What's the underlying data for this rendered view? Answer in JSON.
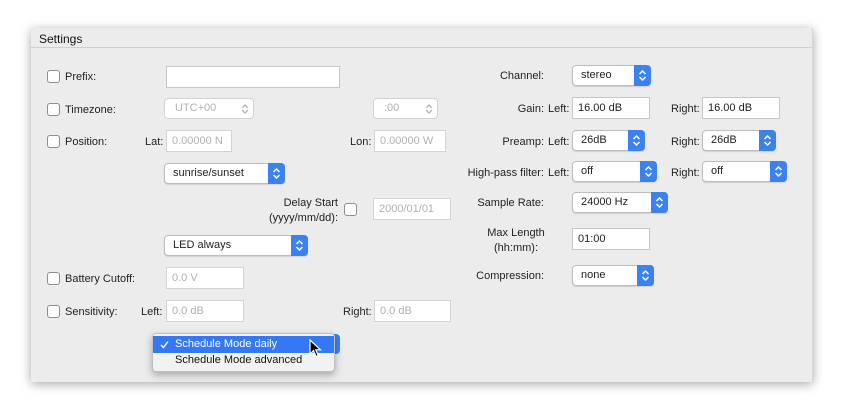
{
  "section_title": "Settings",
  "left": {
    "prefix": {
      "label": "Prefix:",
      "value": ""
    },
    "timezone": {
      "label": "Timezone:",
      "value": "UTC+00",
      "minutes": ":00"
    },
    "position": {
      "label": "Position:",
      "lat_label": "Lat:",
      "lat_value": "0.00000 N",
      "lon_label": "Lon:",
      "lon_value": "0.00000 W"
    },
    "schedule_type": "sunrise/sunset",
    "delay_start": {
      "label_line1": "Delay Start",
      "label_line2": "(yyyy/mm/dd):",
      "value": "2000/01/01"
    },
    "led": "LED always",
    "battery_cutoff": {
      "label": "Battery Cutoff:",
      "value": "0.0 V"
    },
    "sensitivity": {
      "label": "Sensitivity:",
      "left_label": "Left:",
      "left_value": "0.0 dB",
      "right_label": "Right:",
      "right_value": "0.0 dB"
    }
  },
  "right": {
    "channel": {
      "label": "Channel:",
      "value": "stereo"
    },
    "gain": {
      "label": "Gain:",
      "left_label": "Left:",
      "left_value": "16.00 dB",
      "right_label": "Right:",
      "right_value": "16.00 dB"
    },
    "preamp": {
      "label": "Preamp:",
      "left_label": "Left:",
      "left_value": "26dB",
      "right_label": "Right:",
      "right_value": "26dB"
    },
    "highpass": {
      "label": "High-pass filter:",
      "left_label": "Left:",
      "left_value": "off",
      "right_label": "Right:",
      "right_value": "off"
    },
    "sample_rate": {
      "label": "Sample Rate:",
      "value": "24000 Hz"
    },
    "max_length": {
      "label_line1": "Max Length",
      "label_line2": "(hh:mm):",
      "value": "01:00"
    },
    "compression": {
      "label": "Compression:",
      "value": "none"
    }
  },
  "schedule_menu": {
    "items": [
      "Schedule Mode daily",
      "Schedule Mode advanced"
    ],
    "selected_index": 0
  },
  "colors": {
    "accent": "#3b82f0",
    "menu_highlight": "#3478f6"
  }
}
